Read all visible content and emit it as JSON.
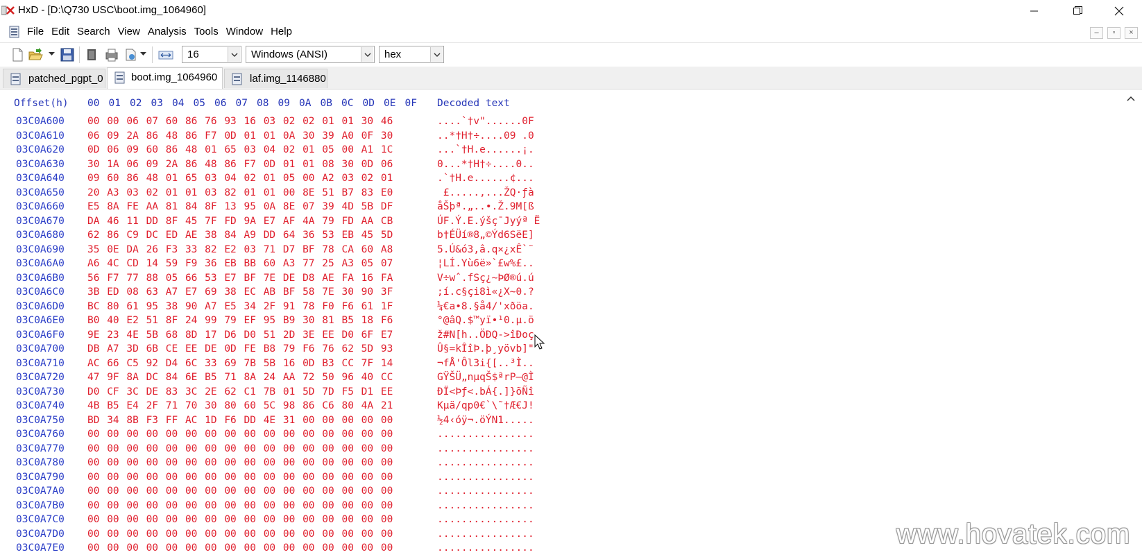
{
  "window": {
    "title": "HxD - [D:\\Q730 USC\\boot.img_1064960]",
    "buttons": [
      "minimize",
      "restore",
      "close"
    ]
  },
  "menu": [
    "File",
    "Edit",
    "Search",
    "View",
    "Analysis",
    "Tools",
    "Window",
    "Help"
  ],
  "toolbar": {
    "bytes_per_row": "16",
    "charset": "Windows (ANSI)",
    "offset_base": "hex"
  },
  "tabs": [
    {
      "label": "patched_pgpt_0",
      "active": false
    },
    {
      "label": "boot.img_1064960",
      "active": true
    },
    {
      "label": "laf.img_1146880",
      "active": false
    }
  ],
  "hex": {
    "header_offset": "Offset(h)",
    "columns": [
      "00",
      "01",
      "02",
      "03",
      "04",
      "05",
      "06",
      "07",
      "08",
      "09",
      "0A",
      "0B",
      "0C",
      "0D",
      "0E",
      "0F"
    ],
    "header_decoded": "Decoded text",
    "rows": [
      {
        "offset": "03C0A600",
        "bytes": "00 00 06 07 60 86 76 93 16 03 02 02 01 01 30 46",
        "text": "....`†v\"......0F"
      },
      {
        "offset": "03C0A610",
        "bytes": "06 09 2A 86 48 86 F7 0D 01 01 0A 30 39 A0 0F 30",
        "text": "..*†H†÷....09 .0"
      },
      {
        "offset": "03C0A620",
        "bytes": "0D 06 09 60 86 48 01 65 03 04 02 01 05 00 A1 1C",
        "text": "...`†H.e......¡."
      },
      {
        "offset": "03C0A630",
        "bytes": "30 1A 06 09 2A 86 48 86 F7 0D 01 01 08 30 0D 06",
        "text": "0...*†H†÷....0.."
      },
      {
        "offset": "03C0A640",
        "bytes": "09 60 86 48 01 65 03 04 02 01 05 00 A2 03 02 01",
        "text": ".`†H.e......¢..."
      },
      {
        "offset": "03C0A650",
        "bytes": "20 A3 03 02 01 01 03 82 01 01 00 8E 51 B7 83 E0",
        "text": " £.....‚...ŽQ·ƒà"
      },
      {
        "offset": "03C0A660",
        "bytes": "E5 8A FE AA 81 84 8F 13 95 0A 8E 07 39 4D 5B DF",
        "text": "åŠþª.„..•.Ž.9M[ß"
      },
      {
        "offset": "03C0A670",
        "bytes": "DA 46 11 DD 8F 45 7F FD 9A E7 AF 4A 79 FD AA CB",
        "text": "ÚF.Ý.E.ýšç¯Jyýª Ë"
      },
      {
        "offset": "03C0A680",
        "bytes": "62 86 C9 DC ED AE 38 84 A9 DD 64 36 53 EB 45 5D",
        "text": "b†ÉÜí®8„©Ýd6SëE]"
      },
      {
        "offset": "03C0A690",
        "bytes": "35 0E DA 26 F3 33 82 E2 03 71 D7 BF 78 CA 60 A8",
        "text": "5.Ú&ó3‚â.q×¿xÊ`¨"
      },
      {
        "offset": "03C0A6A0",
        "bytes": "A6 4C CD 14 59 F9 36 EB BB 60 A3 77 25 A3 05 07",
        "text": "¦LÍ.Yù6ë»`£w%£.."
      },
      {
        "offset": "03C0A6B0",
        "bytes": "56 F7 77 88 05 66 53 E7 BF 7E DE D8 AE FA 16 FA",
        "text": "V÷wˆ.fSç¿~ÞØ®ú.ú"
      },
      {
        "offset": "03C0A6C0",
        "bytes": "3B ED 08 63 A7 E7 69 38 EC AB BF 58 7E 30 90 3F",
        "text": ";í.c§çi8ì«¿X~0.?"
      },
      {
        "offset": "03C0A6D0",
        "bytes": "BC 80 61 95 38 90 A7 E5 34 2F 91 78 F0 F6 61 1F",
        "text": "¼€a•8.§å4/'xðöa."
      },
      {
        "offset": "03C0A6E0",
        "bytes": "B0 40 E2 51 8F 24 99 79 EF 95 B9 30 81 B5 18 F6",
        "text": "°@âQ.$™yï•¹0.µ.ö"
      },
      {
        "offset": "03C0A6F0",
        "bytes": "9E 23 4E 5B 68 8D 17 D6 D0 51 2D 3E EE D0 6F E7",
        "text": "ž#N[h..ÖÐQ->îÐoç"
      },
      {
        "offset": "03C0A700",
        "bytes": "DB A7 3D 6B CE EE DE 0D FE B8 79 F6 76 62 5D 93",
        "text": "Û§=kÎîÞ.þ¸yövb]\""
      },
      {
        "offset": "03C0A710",
        "bytes": "AC 66 C5 92 D4 6C 33 69 7B 5B 16 0D B3 CC 7F 14",
        "text": "¬fÅ'Ôl3i{[..³Ì.."
      },
      {
        "offset": "03C0A720",
        "bytes": "47 9F 8A DC 84 6E B5 71 8A 24 AA 72 50 96 40 CC",
        "text": "GŸŠÜ„nµqŠ$ªrP–@Ì"
      },
      {
        "offset": "03C0A730",
        "bytes": "D0 CF 3C DE 83 3C 2E 62 C1 7B 01 5D 7D F5 D1 EE",
        "text": "ÐÏ<Þƒ<.bÁ{.]}õÑî"
      },
      {
        "offset": "03C0A740",
        "bytes": "4B B5 E4 2F 71 70 30 80 60 5C 98 86 C6 80 4A 21",
        "text": "Kµä/qp0€`\\˜†Æ€J!"
      },
      {
        "offset": "03C0A750",
        "bytes": "BD 34 8B F3 FF AC 1D F6 DD 4E 31 00 00 00 00 00",
        "text": "½4‹óÿ¬.öÝN1....."
      },
      {
        "offset": "03C0A760",
        "bytes": "00 00 00 00 00 00 00 00 00 00 00 00 00 00 00 00",
        "text": "................"
      },
      {
        "offset": "03C0A770",
        "bytes": "00 00 00 00 00 00 00 00 00 00 00 00 00 00 00 00",
        "text": "................"
      },
      {
        "offset": "03C0A780",
        "bytes": "00 00 00 00 00 00 00 00 00 00 00 00 00 00 00 00",
        "text": "................"
      },
      {
        "offset": "03C0A790",
        "bytes": "00 00 00 00 00 00 00 00 00 00 00 00 00 00 00 00",
        "text": "................"
      },
      {
        "offset": "03C0A7A0",
        "bytes": "00 00 00 00 00 00 00 00 00 00 00 00 00 00 00 00",
        "text": "................"
      },
      {
        "offset": "03C0A7B0",
        "bytes": "00 00 00 00 00 00 00 00 00 00 00 00 00 00 00 00",
        "text": "................"
      },
      {
        "offset": "03C0A7C0",
        "bytes": "00 00 00 00 00 00 00 00 00 00 00 00 00 00 00 00",
        "text": "................"
      },
      {
        "offset": "03C0A7D0",
        "bytes": "00 00 00 00 00 00 00 00 00 00 00 00 00 00 00 00",
        "text": "................"
      },
      {
        "offset": "03C0A7E0",
        "bytes": "00 00 00 00 00 00 00 00 00 00 00 00 00 00 00 00",
        "text": "................"
      }
    ]
  },
  "watermark": "www.hovatek.com",
  "colors": {
    "offset_blue": "#2b3ec7",
    "byte_red": "#e0202e",
    "header_blue": "#2636b8"
  }
}
